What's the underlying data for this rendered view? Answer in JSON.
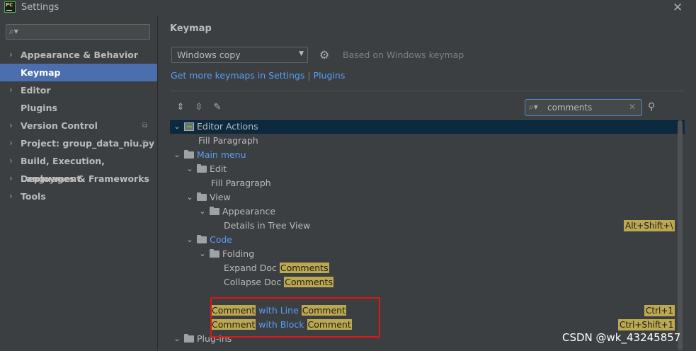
{
  "window": {
    "title": "Settings",
    "app_icon_text": "PC",
    "close_glyph": "✕"
  },
  "sidebar": {
    "search_placeholder": "",
    "items": [
      {
        "label": "Appearance & Behavior",
        "expandable": true
      },
      {
        "label": "Keymap",
        "selected": true
      },
      {
        "label": "Editor",
        "expandable": true
      },
      {
        "label": "Plugins"
      },
      {
        "label": "Version Control",
        "expandable": true,
        "copy_icon": true
      },
      {
        "label": "Project: group_data_niu.py",
        "expandable": true,
        "copy_icon": true
      },
      {
        "label": "Build, Execution, Deployment",
        "expandable": true
      },
      {
        "label": "Languages & Frameworks",
        "expandable": true
      },
      {
        "label": "Tools",
        "expandable": true
      }
    ]
  },
  "main": {
    "title": "Keymap",
    "keymap_select": "Windows copy",
    "based_on": "Based on Windows keymap",
    "link_settings": "Get more keymaps in Settings",
    "link_separator": "|",
    "link_plugins": "Plugins",
    "filter_value": "comments"
  },
  "tree": [
    {
      "text": "Editor Actions",
      "level": 0,
      "arrow": "⌄",
      "icon": "action",
      "selected": true
    },
    {
      "text": "Fill Paragraph",
      "level": 2
    },
    {
      "text": "Main menu",
      "level": 0,
      "arrow": "⌄",
      "icon": "folder",
      "blue": true
    },
    {
      "text": "Edit",
      "level": 1,
      "arrow": "⌄",
      "icon": "folder"
    },
    {
      "text": "Fill Paragraph",
      "level": 3
    },
    {
      "text": "View",
      "level": 1,
      "arrow": "⌄",
      "icon": "folder"
    },
    {
      "text": "Appearance",
      "level": 2,
      "arrow": "⌄",
      "icon": "folder"
    },
    {
      "text": "Details in Tree View",
      "level": 4,
      "shortcut": "Alt+Shift+\\"
    },
    {
      "text": "Code",
      "level": 1,
      "arrow": "⌄",
      "icon": "folder",
      "blue": true
    },
    {
      "text": "Folding",
      "level": 2,
      "arrow": "⌄",
      "icon": "folder"
    },
    {
      "text": "Expand Doc ",
      "level": 4,
      "hl": "Comments"
    },
    {
      "text": "Collapse Doc ",
      "level": 4,
      "hl": "Comments"
    },
    {
      "text": "",
      "level": 4
    },
    {
      "hl1": "Comment",
      "mid": " with Line ",
      "hl2": "Comment",
      "level": 3,
      "shortcut": "Ctrl+1"
    },
    {
      "hl1": "Comment",
      "mid": " with Block ",
      "hl2": "Comment",
      "level": 3,
      "shortcut": "Ctrl+Shift+1"
    },
    {
      "text": "Plug-ins",
      "level": 0,
      "arrow": "⌄",
      "icon": "folder"
    }
  ],
  "watermark": "CSDN @wk_43245857",
  "colors": {
    "accent": "#4b6eaf",
    "highlight": "#bba850",
    "link": "#589df6",
    "annotation": "#e01515"
  }
}
